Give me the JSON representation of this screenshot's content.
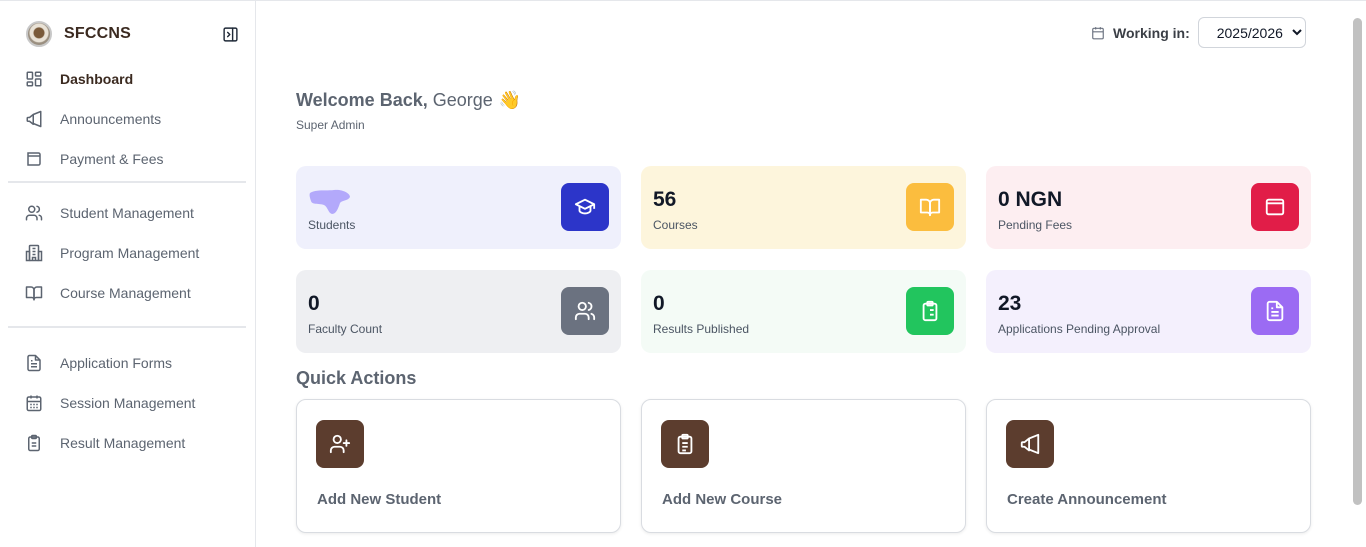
{
  "brand": {
    "name": "SFCCNS"
  },
  "sidebar": {
    "items": [
      {
        "label": "Dashboard",
        "icon": "dashboard-icon",
        "active": true
      },
      {
        "label": "Announcements",
        "icon": "megaphone-icon"
      },
      {
        "label": "Payment & Fees",
        "icon": "wallet-icon"
      },
      {
        "label": "Student Management",
        "icon": "users-icon"
      },
      {
        "label": "Program Management",
        "icon": "building-icon"
      },
      {
        "label": "Course Management",
        "icon": "book-icon"
      },
      {
        "label": "Application Forms",
        "icon": "document-icon"
      },
      {
        "label": "Session Management",
        "icon": "calendar-icon"
      },
      {
        "label": "Result Management",
        "icon": "clipboard-icon"
      }
    ]
  },
  "header": {
    "working_label": "Working in:",
    "session_value": "2025/2026",
    "session_options": [
      "2025/2026"
    ]
  },
  "welcome": {
    "greeting": "Welcome Back,",
    "name": "George",
    "emoji": "👋",
    "role": "Super Admin"
  },
  "stats": [
    {
      "value": "",
      "label": "Students",
      "icon": "graduation-cap-icon",
      "bg": "#eff0fc",
      "accent": "#2c35c9"
    },
    {
      "value": "56",
      "label": "Courses",
      "icon": "book-open-icon",
      "bg": "#fdf5dc",
      "accent": "#fbbd3e"
    },
    {
      "value": "0 NGN",
      "label": "Pending Fees",
      "icon": "wallet-icon",
      "bg": "#fdeef1",
      "accent": "#e11d48"
    },
    {
      "value": "0",
      "label": "Faculty Count",
      "icon": "users-icon",
      "bg": "#eeeff2",
      "accent": "#6b7280"
    },
    {
      "value": "0",
      "label": "Results Published",
      "icon": "clipboard-list-icon",
      "bg": "#f4fbf6",
      "accent": "#22c55e"
    },
    {
      "value": "23",
      "label": "Applications Pending Approval",
      "icon": "file-text-icon",
      "bg": "#f4f0fd",
      "accent": "#9b6bf3"
    }
  ],
  "quick_actions": {
    "title": "Quick Actions",
    "items": [
      {
        "label": "Add New Student",
        "icon": "user-plus-icon"
      },
      {
        "label": "Add New Course",
        "icon": "clipboard-icon"
      },
      {
        "label": "Create Announcement",
        "icon": "megaphone-icon"
      }
    ]
  },
  "colors": {
    "brand_brown": "#5c3d2e",
    "active_text": "#3b2a20",
    "muted_text": "#5c6470"
  }
}
